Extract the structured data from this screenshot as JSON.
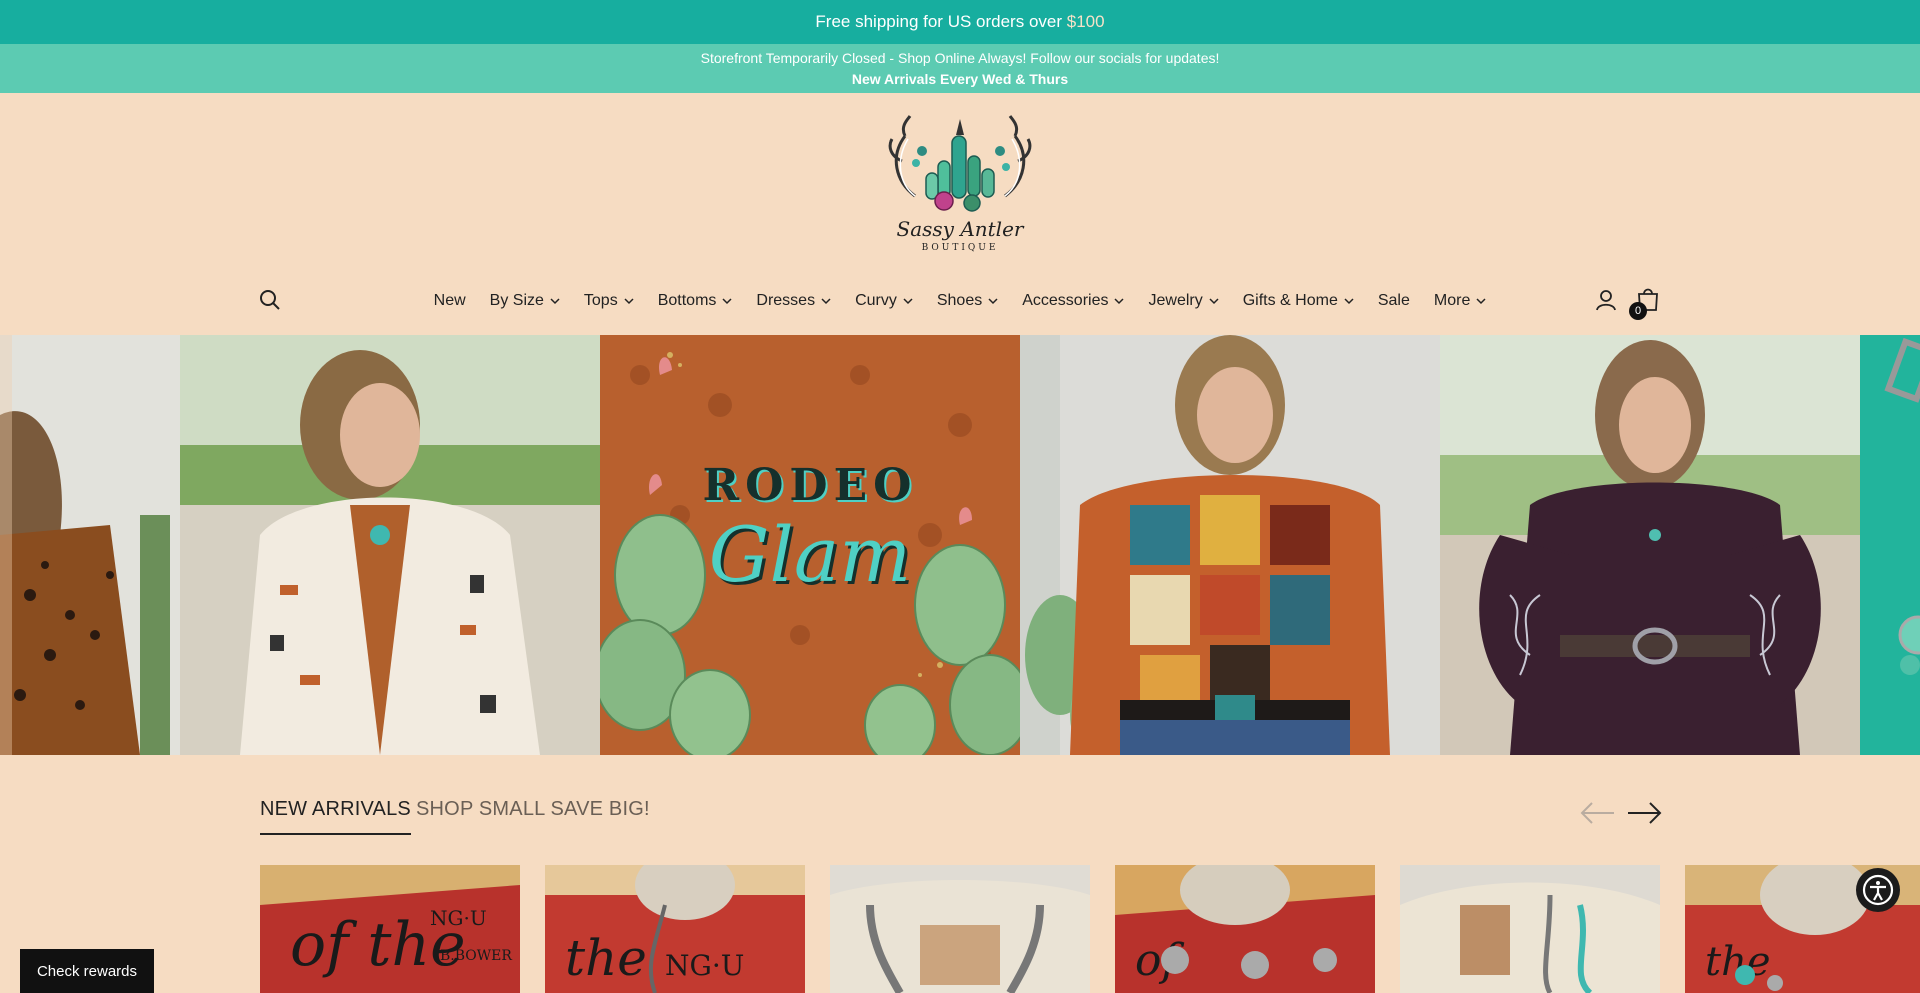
{
  "announcement": {
    "text": "Free shipping for US orders over ",
    "amount": "$100"
  },
  "notice": {
    "line1": "Storefront Temporarily Closed - Shop Online Always! Follow our socials for updates!",
    "line2": "New Arrivals Every Wed & Thurs"
  },
  "logo": {
    "name": "Sassy Antler",
    "subtitle": "BOUTIQUE"
  },
  "nav": {
    "items": [
      {
        "label": "New",
        "dropdown": false
      },
      {
        "label": "By Size",
        "dropdown": true
      },
      {
        "label": "Tops",
        "dropdown": true
      },
      {
        "label": "Bottoms",
        "dropdown": true
      },
      {
        "label": "Dresses",
        "dropdown": true
      },
      {
        "label": "Curvy",
        "dropdown": true
      },
      {
        "label": "Shoes",
        "dropdown": true
      },
      {
        "label": "Accessories",
        "dropdown": true
      },
      {
        "label": "Jewelry",
        "dropdown": true
      },
      {
        "label": "Gifts & Home",
        "dropdown": true
      },
      {
        "label": "Sale",
        "dropdown": false
      },
      {
        "label": "More",
        "dropdown": true
      }
    ]
  },
  "cart": {
    "count": "0"
  },
  "hero": {
    "banner_word1": "RODEO",
    "banner_word2": "Glam"
  },
  "collections": {
    "tabs": [
      "NEW ARRIVALS",
      "SHOP SMALL SAVE BIG!"
    ],
    "active_tab": 0
  },
  "rewards": {
    "label": "Check rewards"
  },
  "icons": {
    "search": "search-icon",
    "account": "user-icon",
    "cart": "shopping-bag-icon",
    "prev": "arrow-left-icon",
    "next": "arrow-right-icon",
    "accessibility": "accessibility-icon"
  },
  "colors": {
    "announcement_bg": "#17ae9f",
    "notice_bg": "#5ccbb2",
    "page_bg": "#f6dcc2",
    "accent_dark": "#111111"
  }
}
